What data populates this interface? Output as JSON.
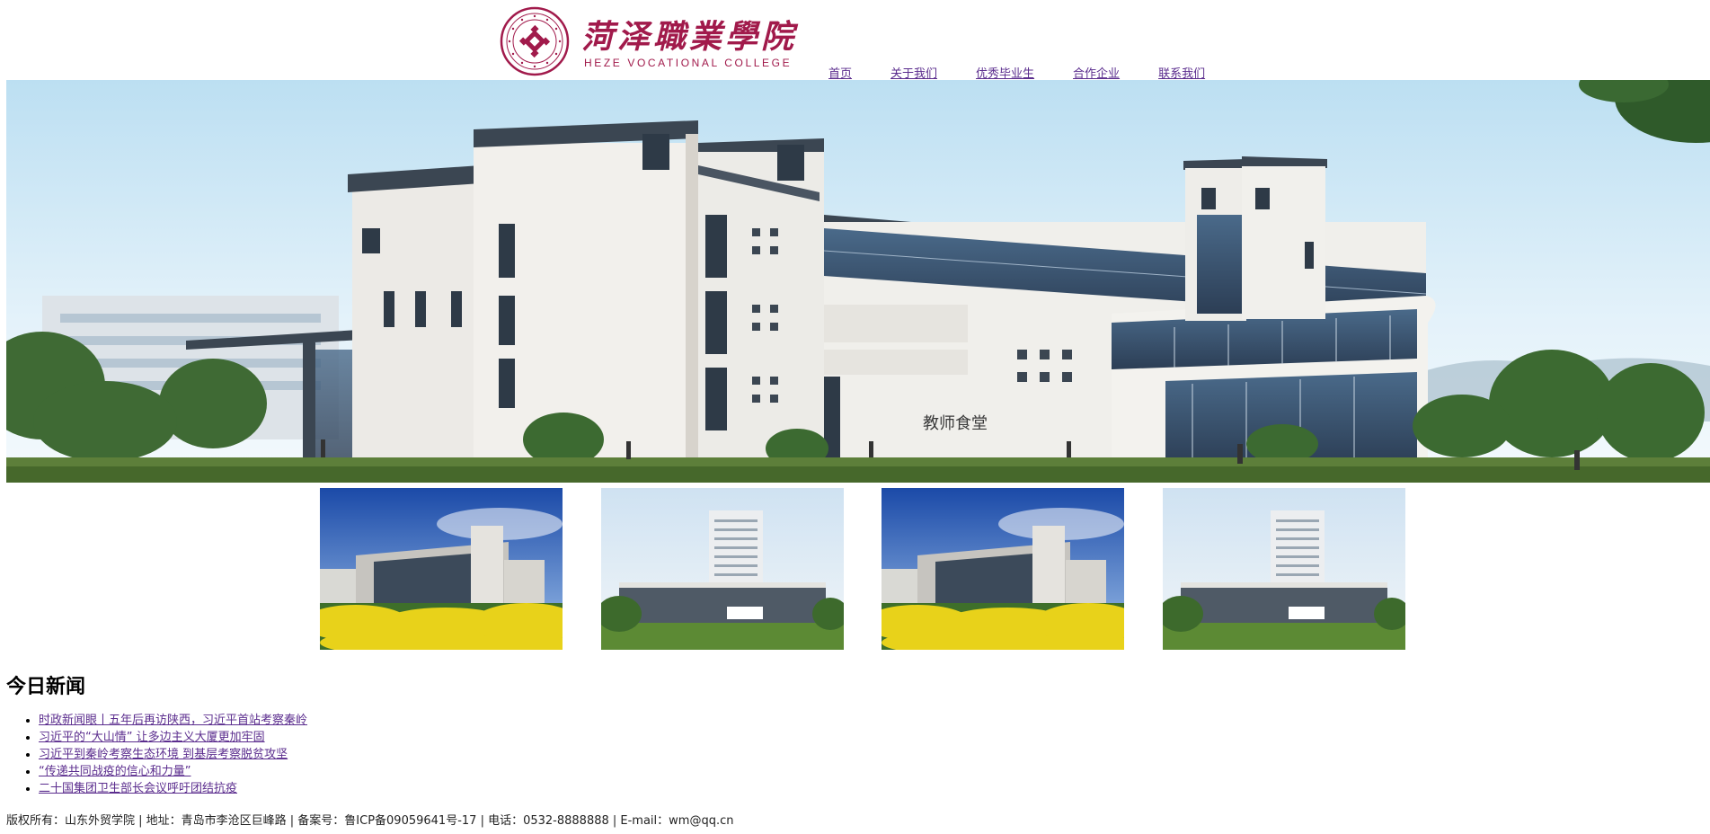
{
  "header": {
    "logo_cn": "菏泽職業學院",
    "logo_en": "HEZE VOCATIONAL COLLEGE",
    "brand_color": "#a11a4b"
  },
  "nav": {
    "items": [
      {
        "label": "首页"
      },
      {
        "label": "关于我们"
      },
      {
        "label": "优秀毕业生"
      },
      {
        "label": "合作企业"
      },
      {
        "label": "联系我们"
      }
    ],
    "link_color": "#5b2d8e"
  },
  "banner": {
    "sign_text": "教师食堂"
  },
  "news": {
    "title": "今日新闻",
    "items": [
      {
        "label": "时政新闻眼丨五年后再访陕西，习近平首站考察秦岭"
      },
      {
        "label": "习近平的“大山情” 让多边主义大厦更加牢固"
      },
      {
        "label": "习近平到秦岭考察生态环境 到基层考察脱贫攻坚"
      },
      {
        "label": "“传递共同战疫的信心和力量”"
      },
      {
        "label": "二十国集团卫生部长会议呼吁团结抗疫"
      }
    ]
  },
  "footer": {
    "text": "版权所有：山东外贸学院 | 地址：青岛市李沧区巨峰路 | 备案号：鲁ICP备09059641号-17 | 电话：0532-8888888 | E-mail：wm@qq.cn"
  }
}
